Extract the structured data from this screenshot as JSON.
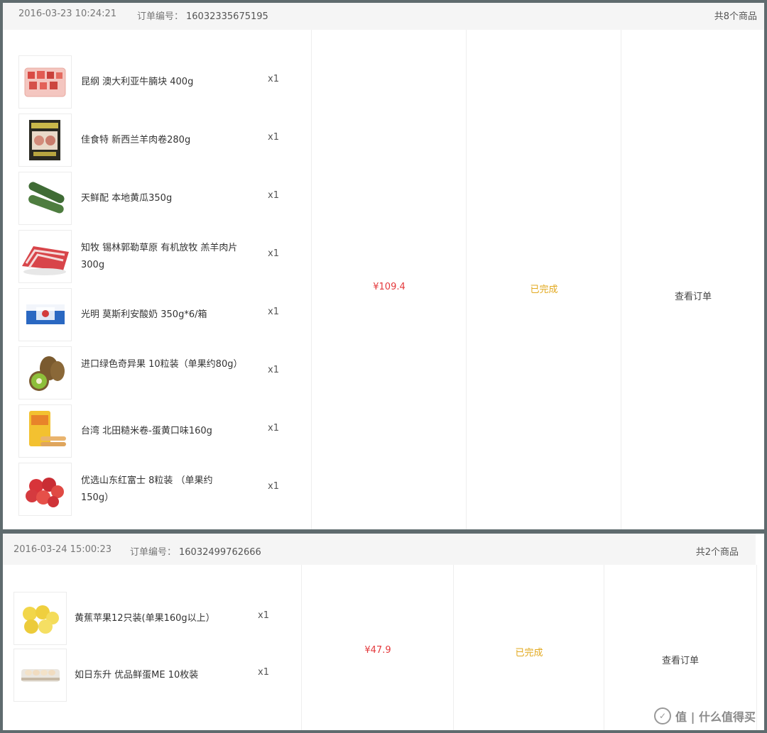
{
  "orders": [
    {
      "date": "2016-03-23 10:24:21",
      "order_label": "订单编号：",
      "order_number": "16032335675195",
      "count_text": "共8个商品",
      "price": "¥109.4",
      "status": "已完成",
      "action": "查看订单",
      "items": [
        {
          "name": "昆纲 澳大利亚牛腩块 400g",
          "qty": "x1",
          "icon": "beef-cubes-image"
        },
        {
          "name": "佳食特 新西兰羊肉卷280g",
          "qty": "x1",
          "icon": "lamb-roll-image"
        },
        {
          "name": "天鲜配 本地黄瓜350g",
          "qty": "x1",
          "icon": "cucumber-image"
        },
        {
          "name": "知牧 锡林郭勒草原 有机放牧 羔羊肉片 300g",
          "qty": "x1",
          "icon": "lamb-slices-image"
        },
        {
          "name": "光明 莫斯利安酸奶 350g*6/箱",
          "qty": "x1",
          "icon": "yogurt-box-image"
        },
        {
          "name": "进口绿色奇异果 10粒装（单果约80g）",
          "qty": "x1",
          "icon": "kiwi-image"
        },
        {
          "name": "台湾 北田糙米卷-蛋黄口味160g",
          "qty": "x1",
          "icon": "rice-roll-snack-image"
        },
        {
          "name": "优选山东红富士 8粒装 （单果约150g）",
          "qty": "x1",
          "icon": "red-apples-image"
        }
      ]
    },
    {
      "date": "2016-03-24 15:00:23",
      "order_label": "订单编号：",
      "order_number": "16032499762666",
      "count_text": "共2个商品",
      "price": "¥47.9",
      "status": "已完成",
      "action": "查看订单",
      "items": [
        {
          "name": "黄蕉苹果12只装(单果160g以上）",
          "qty": "x1",
          "icon": "yellow-apples-image"
        },
        {
          "name": "如日东升 优品鲜蛋ME 10枚装",
          "qty": "x1",
          "icon": "eggs-image"
        }
      ]
    }
  ],
  "watermark": {
    "text": "值 | 什么值得买",
    "icon": "smzdm-logo-icon"
  }
}
